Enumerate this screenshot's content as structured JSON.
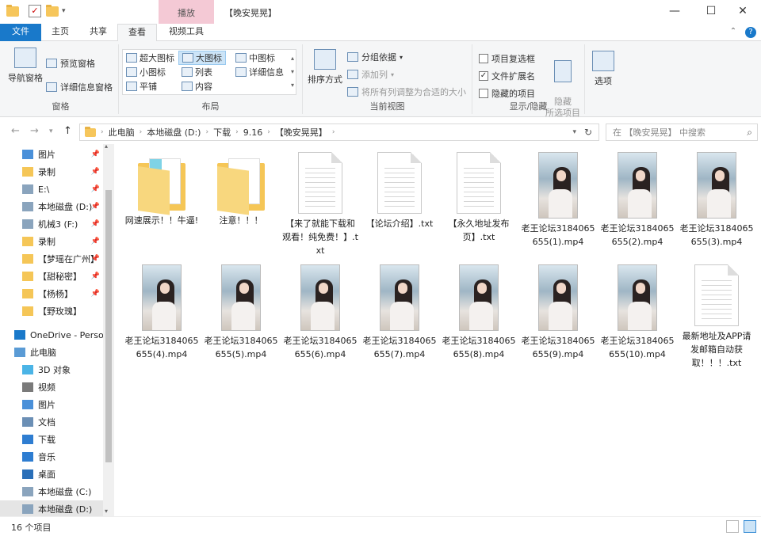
{
  "window": {
    "title": "【晚安晃晃】",
    "context_tab": "播放"
  },
  "tabs": [
    {
      "label": "文件"
    },
    {
      "label": "主页"
    },
    {
      "label": "共享"
    },
    {
      "label": "查看"
    },
    {
      "label": "视频工具"
    }
  ],
  "ribbon": {
    "panes": {
      "label": "窗格",
      "nav_pane": "导航窗格",
      "preview_pane": "预览窗格",
      "details_pane": "详细信息窗格"
    },
    "layout": {
      "label": "布局",
      "items": [
        "超大图标",
        "大图标",
        "中图标",
        "小图标",
        "列表",
        "详细信息",
        "平铺",
        "内容"
      ],
      "selected": "大图标"
    },
    "current_view": {
      "label": "当前视图",
      "sort_by": "排序方式",
      "group_by": "分组依据",
      "add_columns": "添加列",
      "size_all_columns": "将所有列调整为合适的大小"
    },
    "show_hide": {
      "label": "显示/隐藏",
      "item_checkboxes": "项目复选框",
      "file_extensions": "文件扩展名",
      "hidden_items": "隐藏的项目",
      "hide_selected": "隐藏\n所选项目",
      "file_extensions_checked": true
    },
    "options": {
      "label": "选项"
    }
  },
  "address": {
    "crumbs": [
      "此电脑",
      "本地磁盘 (D:)",
      "下载",
      "9.16",
      "【晚安晃晃】"
    ],
    "search_placeholder": "在 【晚安晃晃】 中搜索"
  },
  "nav": {
    "items": [
      {
        "label": "图片",
        "icon": "pictures-icon",
        "pinned": true
      },
      {
        "label": "录制",
        "icon": "folder-icon",
        "pinned": true
      },
      {
        "label": "E:\\",
        "icon": "drive-icon",
        "pinned": true
      },
      {
        "label": "本地磁盘 (D:)",
        "icon": "drive-icon",
        "pinned": true
      },
      {
        "label": "机械3 (F:)",
        "icon": "drive-icon",
        "pinned": true
      },
      {
        "label": "录制",
        "icon": "download-folder-icon",
        "pinned": true
      },
      {
        "label": "【梦瑶在广州】",
        "icon": "folder-icon",
        "pinned": true
      },
      {
        "label": "【甜秘密】",
        "icon": "folder-icon",
        "pinned": true
      },
      {
        "label": "【杨杨】",
        "icon": "folder-icon",
        "pinned": true
      },
      {
        "label": "【野玫瑰】",
        "icon": "folder-icon",
        "pinned": false
      },
      {
        "label": "OneDrive - Personal",
        "icon": "onedrive-icon",
        "pinned": false
      },
      {
        "label": "此电脑",
        "icon": "this-pc-icon",
        "pinned": false
      },
      {
        "label": "3D 对象",
        "icon": "3d-objects-icon",
        "pinned": false
      },
      {
        "label": "视频",
        "icon": "videos-icon",
        "pinned": false
      },
      {
        "label": "图片",
        "icon": "pictures-icon",
        "pinned": false
      },
      {
        "label": "文档",
        "icon": "documents-icon",
        "pinned": false
      },
      {
        "label": "下载",
        "icon": "downloads-icon",
        "pinned": false
      },
      {
        "label": "音乐",
        "icon": "music-icon",
        "pinned": false
      },
      {
        "label": "桌面",
        "icon": "desktop-icon",
        "pinned": false
      },
      {
        "label": "本地磁盘 (C:)",
        "icon": "drive-icon",
        "pinned": false
      },
      {
        "label": "本地磁盘 (D:)",
        "icon": "drive-icon",
        "pinned": false
      }
    ]
  },
  "files": [
    {
      "name": "网速展示！！牛逼!",
      "type": "folder"
    },
    {
      "name": "注意！！！",
      "type": "folder"
    },
    {
      "name": "【来了就能下载和观看！纯免费！】.txt",
      "type": "txt"
    },
    {
      "name": "【论坛介绍】.txt",
      "type": "txt"
    },
    {
      "name": "【永久地址发布页】.txt",
      "type": "txt"
    },
    {
      "name": "老王论坛3184065655(1).mp4",
      "type": "video"
    },
    {
      "name": "老王论坛3184065655(2).mp4",
      "type": "video"
    },
    {
      "name": "老王论坛3184065655(3).mp4",
      "type": "video"
    },
    {
      "name": "老王论坛3184065655(4).mp4",
      "type": "video"
    },
    {
      "name": "老王论坛3184065655(5).mp4",
      "type": "video"
    },
    {
      "name": "老王论坛3184065655(6).mp4",
      "type": "video"
    },
    {
      "name": "老王论坛3184065655(7).mp4",
      "type": "video"
    },
    {
      "name": "老王论坛3184065655(8).mp4",
      "type": "video"
    },
    {
      "name": "老王论坛3184065655(9).mp4",
      "type": "video"
    },
    {
      "name": "老王论坛3184065655(10).mp4",
      "type": "video"
    },
    {
      "name": "最新地址及APP请发邮箱自动获取！！！.txt",
      "type": "txt"
    }
  ],
  "status": {
    "count": "16 个项目"
  },
  "colors": {
    "accent": "#1979ca",
    "context_tab": "#f4c9d5",
    "folder": "#f5c657",
    "selection": "#cce4f7"
  }
}
